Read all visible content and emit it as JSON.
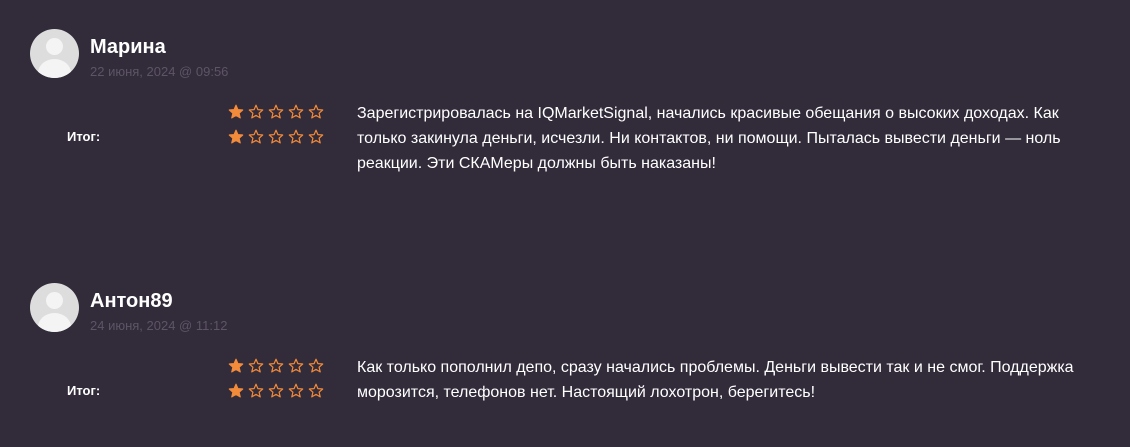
{
  "colors": {
    "background": "#322b3a",
    "star_filled": "#f28b3a",
    "star_outline": "#f28b3a",
    "date_text": "#5d5566"
  },
  "reviews": [
    {
      "author": "Марина",
      "date": "22 июня, 2024 @ 09:56",
      "total_label": "Итог:",
      "rating_rows": [
        1,
        1
      ],
      "max_stars": 5,
      "text": "Зарегистрировалась на IQMarketSignal, начались красивые обещания о высоких доходах. Как только закинула деньги, исчезли. Ни контактов, ни помощи. Пыталась вывести деньги — ноль реакции. Эти СКАМеры должны быть наказаны!"
    },
    {
      "author": "Антон89",
      "date": "24 июня, 2024 @ 11:12",
      "total_label": "Итог:",
      "rating_rows": [
        1,
        1
      ],
      "max_stars": 5,
      "text": "Как только пополнил депо, сразу начались проблемы. Деньги вывести так и не смог. Поддержка морозится, телефонов нет. Настоящий лохотрон, берегитесь!"
    }
  ]
}
